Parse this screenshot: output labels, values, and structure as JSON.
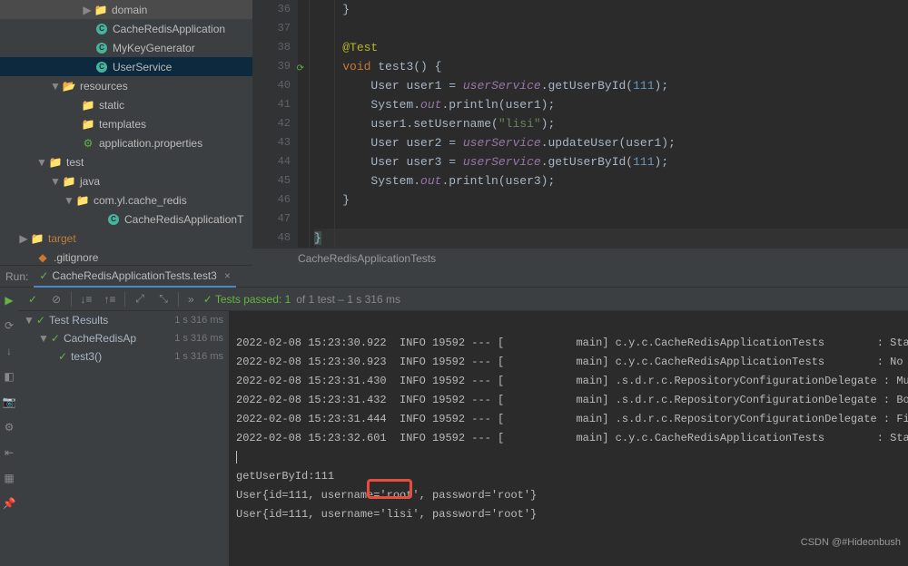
{
  "tree": {
    "domain": "domain",
    "cacheApp": "CacheRedisApplication",
    "myKeyGen": "MyKeyGenerator",
    "userService": "UserService",
    "resources": "resources",
    "static": "static",
    "templates": "templates",
    "appProps": "application.properties",
    "test": "test",
    "java": "java",
    "pkgTest": "com.yl.cache_redis",
    "cacheAppTest": "CacheRedisApplicationT",
    "target": "target",
    "gitignore": ".gitignore"
  },
  "editor": {
    "lines": [
      "36",
      "37",
      "38",
      "39",
      "40",
      "41",
      "42",
      "43",
      "44",
      "45",
      "46",
      "47",
      "48"
    ],
    "l36_close": "}",
    "l38_anno": "@Test",
    "l39_void": "void",
    "l39_name": " test3() {",
    "l40_pre": "    User ",
    "l40_var": "user1",
    "l40_eq": " = ",
    "l40_field": "userService",
    "l40_call": ".getUserById(",
    "l40_num": "111",
    "l40_end": ");",
    "l41_pre": "    System.",
    "l41_out": "out",
    "l41_call": ".println(user1);",
    "l42_pre": "    user1.setUsername(",
    "l42_str": "\"lisi\"",
    "l42_end": ");",
    "l43_pre": "    User ",
    "l43_var": "user2",
    "l43_eq": " = ",
    "l43_field": "userService",
    "l43_call": ".updateUser(user1);",
    "l44_pre": "    User ",
    "l44_var": "user3",
    "l44_eq": " = ",
    "l44_field": "userService",
    "l44_call": ".getUserById(",
    "l44_num": "111",
    "l44_end": ");",
    "l45_pre": "    System.",
    "l45_out": "out",
    "l45_call": ".println(user3);",
    "l46_close": "}",
    "l48_close": "}",
    "breadcrumb": "CacheRedisApplicationTests"
  },
  "run": {
    "label": "Run:",
    "tabName": "CacheRedisApplicationTests.test3",
    "passedPrefix": "✓ Tests passed: 1",
    "passedSuffix": " of 1 test – 1 s 316 ms",
    "testResults": "Test Results",
    "testClass": "CacheRedisAp",
    "testMethod": "test3()",
    "time": "1 s 316 ms",
    "console": {
      "l1": "2022-02-08 15:23:30.922  INFO 19592 --- [           main] c.y.c.CacheRedisApplicationTests        : Starti",
      "l2": "2022-02-08 15:23:30.923  INFO 19592 --- [           main] c.y.c.CacheRedisApplicationTests        : No act",
      "l3": "2022-02-08 15:23:31.430  INFO 19592 --- [           main] .s.d.r.c.RepositoryConfigurationDelegate : Multip",
      "l4": "2022-02-08 15:23:31.432  INFO 19592 --- [           main] .s.d.r.c.RepositoryConfigurationDelegate : Boots",
      "l5": "2022-02-08 15:23:31.444  INFO 19592 --- [           main] .s.d.r.c.RepositoryConfigurationDelegate : Finish",
      "l6": "2022-02-08 15:23:32.601  INFO 19592 --- [           main] c.y.c.CacheRedisApplicationTests        : Starte",
      "l8": "getUserById:111",
      "l9": "User{id=111, username='root', password='root'}",
      "l10": "User{id=111, username='lisi', password='root'}"
    }
  },
  "watermark": "CSDN @#Hideonbush"
}
